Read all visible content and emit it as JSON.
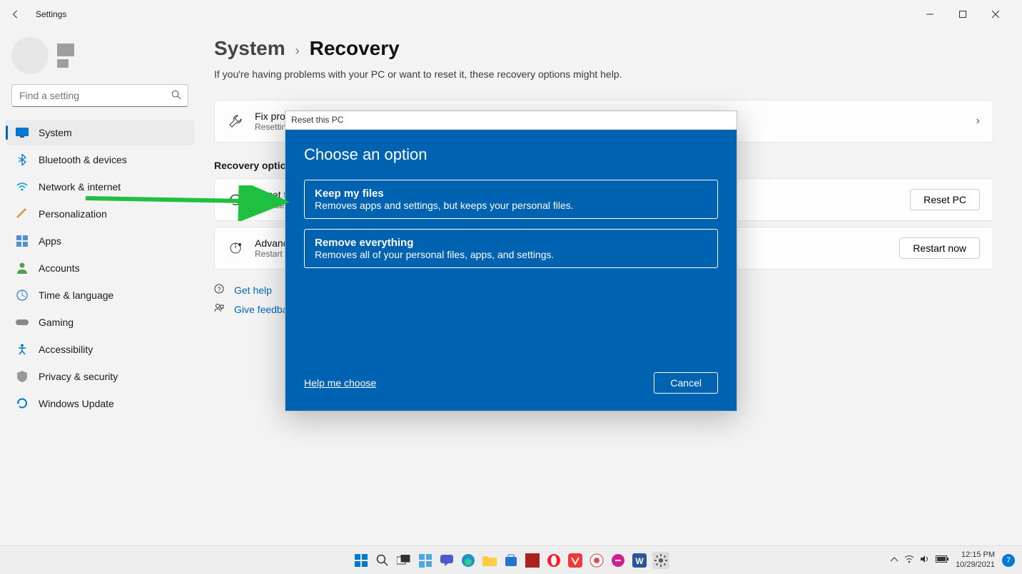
{
  "titlebar": {
    "title": "Settings"
  },
  "search": {
    "placeholder": "Find a setting"
  },
  "nav": {
    "items": [
      {
        "label": "System",
        "icon": "display"
      },
      {
        "label": "Bluetooth & devices",
        "icon": "bluetooth"
      },
      {
        "label": "Network & internet",
        "icon": "wifi"
      },
      {
        "label": "Personalization",
        "icon": "brush"
      },
      {
        "label": "Apps",
        "icon": "apps"
      },
      {
        "label": "Accounts",
        "icon": "person"
      },
      {
        "label": "Time & language",
        "icon": "globe"
      },
      {
        "label": "Gaming",
        "icon": "game"
      },
      {
        "label": "Accessibility",
        "icon": "accessibility"
      },
      {
        "label": "Privacy & security",
        "icon": "shield"
      },
      {
        "label": "Windows Update",
        "icon": "update"
      }
    ],
    "active_index": 0
  },
  "breadcrumb": {
    "parent": "System",
    "current": "Recovery"
  },
  "subtitle": "If you're having problems with your PC or want to reset it, these recovery options might help.",
  "cards": {
    "fix": {
      "title": "Fix problems",
      "sub": "Resetting"
    },
    "section_heading": "Recovery options",
    "reset": {
      "title": "Reset this PC",
      "sub": "Choose to keep or remove files",
      "button": "Reset PC"
    },
    "advanced": {
      "title": "Advanced startup",
      "sub": "Restart your device",
      "button": "Restart now"
    }
  },
  "help_links": {
    "get_help": "Get help",
    "feedback": "Give feedback"
  },
  "dialog": {
    "window_title": "Reset this PC",
    "heading": "Choose an option",
    "option1": {
      "title": "Keep my files",
      "desc": "Removes apps and settings, but keeps your personal files."
    },
    "option2": {
      "title": "Remove everything",
      "desc": "Removes all of your personal files, apps, and settings."
    },
    "help_link": "Help me choose",
    "cancel": "Cancel"
  },
  "taskbar": {
    "time": "12:15 PM",
    "date": "10/29/2021",
    "notif_count": "7"
  }
}
